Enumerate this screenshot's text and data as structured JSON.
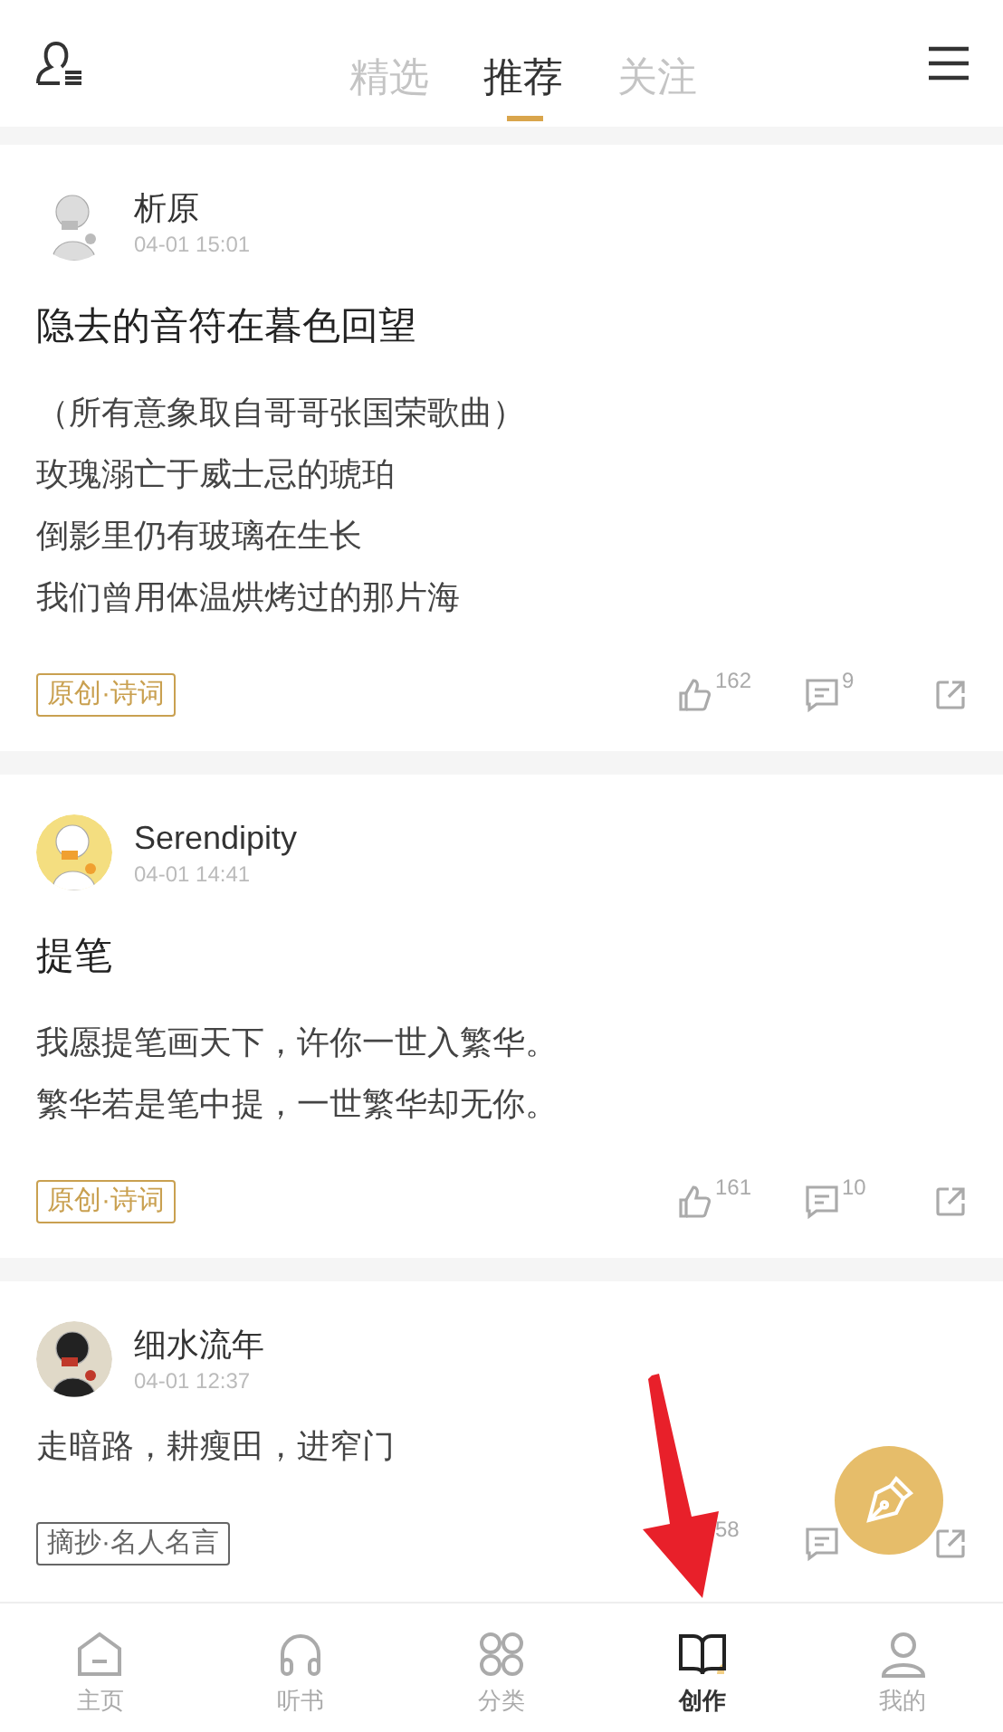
{
  "tabs": [
    {
      "label": "精选",
      "selected": false
    },
    {
      "label": "推荐",
      "selected": true
    },
    {
      "label": "关注",
      "selected": false
    }
  ],
  "posts": [
    {
      "author": "析原",
      "time": "04-01 15:01",
      "title": "隐去的音符在暮色回望",
      "lines": [
        "（所有意象取自哥哥张国荣歌曲）",
        "玫瑰溺亡于威士忌的琥珀",
        "倒影里仍有玻璃在生长",
        "我们曾用体温烘烤过的那片海"
      ],
      "tag": {
        "text": "原创·诗词",
        "color": "#c9a050"
      },
      "likes": "162",
      "comments": "9"
    },
    {
      "author": "Serendipity",
      "time": "04-01 14:41",
      "title": "提笔",
      "lines": [
        "我愿提笔画天下，许你一世入繁华。",
        "繁华若是笔中提，一世繁华却无你。"
      ],
      "tag": {
        "text": "原创·诗词",
        "color": "#c9a050"
      },
      "likes": "161",
      "comments": "10"
    },
    {
      "author": "细水流年",
      "time": "04-01 12:37",
      "lines": [
        "走暗路，耕瘦田，进窄门"
      ],
      "tag": {
        "text": "摘抄·名人名言",
        "color": "#666666"
      },
      "likes": "58"
    }
  ],
  "nav": [
    {
      "label": "主页",
      "selected": false
    },
    {
      "label": "听书",
      "selected": false
    },
    {
      "label": "分类",
      "selected": false
    },
    {
      "label": "创作",
      "selected": true
    },
    {
      "label": "我的",
      "selected": false
    }
  ]
}
